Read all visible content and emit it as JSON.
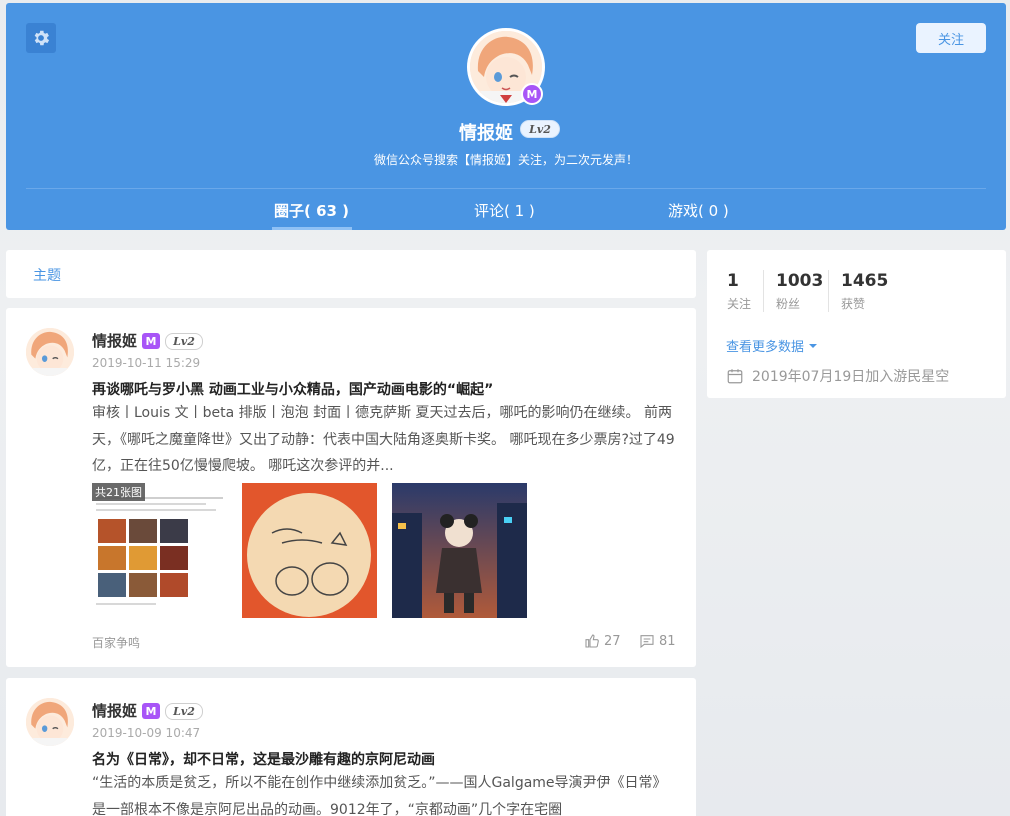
{
  "colors": {
    "accent": "#4a95e3",
    "header_bg": "#4a95e3",
    "badge_purple": "#a855f7"
  },
  "header": {
    "settings_icon": "gear-icon",
    "follow_label": "关注",
    "username": "情报姬",
    "badge_letter": "M",
    "level": "Lv2",
    "bio": "微信公众号搜索【情报姬】关注，为二次元发声！",
    "tabs": [
      {
        "label": "圈子( 63 )",
        "active": true
      },
      {
        "label": "评论( 1 )",
        "active": false
      },
      {
        "label": "游戏( 0 )",
        "active": false
      }
    ]
  },
  "topic_bar": {
    "label": "主题"
  },
  "posts": [
    {
      "author": "情报姬",
      "badge_letter": "M",
      "level": "Lv2",
      "time": "2019-10-11 15:29",
      "title": "再谈哪吒与罗小黑 动画工业与小众精品，国产动画电影的“崛起”",
      "excerpt": "审核丨Louis 文丨beta      排版丨泡泡 封面丨德克萨斯      夏天过去后，哪吒的影响仍在继续。      前两天，《哪吒之魔童降世》又出了动静：代表中国大陆角逐奥斯卡奖。      哪吒现在多少票房?过了49亿，正在往50亿慢慢爬坡。      哪吒这次参评的并...",
      "image_count": "共21张图",
      "category": "百家争鸣",
      "likes": "27",
      "comments": "81"
    },
    {
      "author": "情报姬",
      "badge_letter": "M",
      "level": "Lv2",
      "time": "2019-10-09 10:47",
      "title": "名为《日常》，却不日常，这是最沙雕有趣的京阿尼动画",
      "excerpt": "“生活的本质是贫乏，所以不能在创作中继续添加贫乏。”——国人Galgame导演尹伊《日常》是一部根本不像是京阿尼出品的动画。9012年了，“京都动画”几个字在宅圈"
    }
  ],
  "stats": {
    "following": {
      "value": "1",
      "label": "关注"
    },
    "followers": {
      "value": "1003",
      "label": "粉丝"
    },
    "likes": {
      "value": "1465",
      "label": "获赞"
    },
    "more_data": "查看更多数据",
    "join_date": "2019年07月19日加入游民星空"
  }
}
